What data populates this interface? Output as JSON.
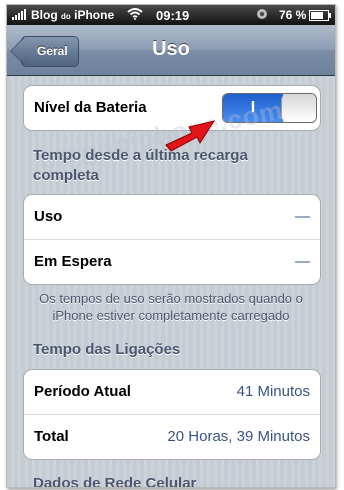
{
  "status_bar": {
    "carrier": "Blog",
    "carrier_small": "do",
    "carrier_end": "iPhone",
    "time": "09:19",
    "battery": "76 %"
  },
  "nav": {
    "back_label": "Geral",
    "title": "Uso"
  },
  "battery_level": {
    "label": "Nível da Bateria",
    "toggle_on_text": "I",
    "toggle_state": "on"
  },
  "watermark": "blogdoiphone.com",
  "section_since_charge": {
    "header": "Tempo desde a última recarga completa",
    "rows": [
      {
        "label": "Uso",
        "value": "—"
      },
      {
        "label": "Em Espera",
        "value": "—"
      }
    ],
    "footer": "Os tempos de uso serão mostrados quando o iPhone estiver completamente carregado"
  },
  "section_calls": {
    "header": "Tempo das Ligações",
    "rows": [
      {
        "label": "Período Atual",
        "value": "41 Minutos"
      },
      {
        "label": "Total",
        "value": "20 Horas, 39 Minutos"
      }
    ]
  },
  "section_cellular": {
    "header": "Dados de Rede Celular"
  },
  "colors": {
    "toggle_blue": "#2f73df",
    "arrow_red": "#e5141b",
    "value_blue": "#385487",
    "header_text": "#4c566c"
  }
}
